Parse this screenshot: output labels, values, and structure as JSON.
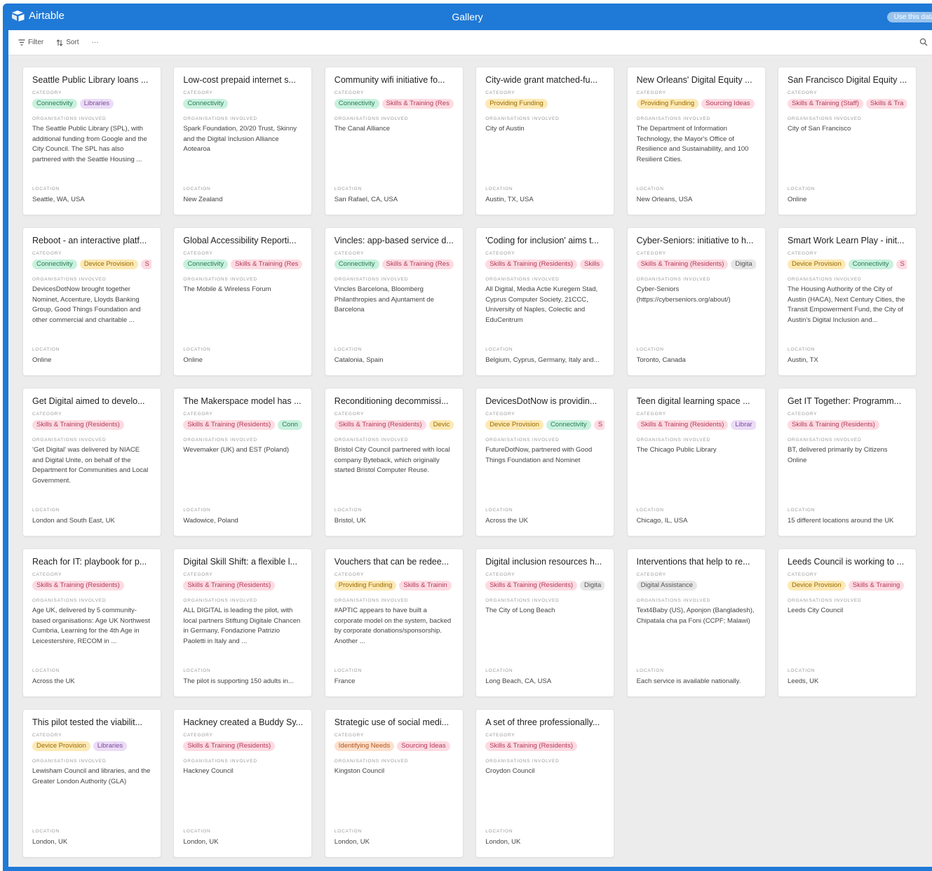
{
  "app": {
    "name": "Airtable",
    "view_title": "Gallery",
    "use_data_button": "Use this data"
  },
  "toolbar": {
    "filter_label": "Filter",
    "sort_label": "Sort",
    "more_label": "···"
  },
  "labels": {
    "category": "CATEGORY",
    "orgs": "ORGANISATIONS INVOLVED",
    "location": "LOCATION"
  },
  "tag_colors": {
    "Connectivity": {
      "bg": "#c8f1de",
      "fg": "#2a7a55"
    },
    "Libraries": {
      "bg": "#ecdcf7",
      "fg": "#7a4a99"
    },
    "Skills & Training": {
      "bg": "#fddbe2",
      "fg": "#b33a5a"
    },
    "Providing Funding": {
      "bg": "#fde9b5",
      "fg": "#9a6b00"
    },
    "Sourcing Ideas": {
      "bg": "#fddbe2",
      "fg": "#b33a5a"
    },
    "Device Provision": {
      "bg": "#fde9b5",
      "fg": "#9a6b00"
    },
    "Identifying Needs": {
      "bg": "#fde0cc",
      "fg": "#b0551e"
    },
    "Digital Assistance": {
      "bg": "#e6e6e6",
      "fg": "#555555"
    }
  },
  "cards": [
    {
      "title": "Seattle Public Library loans ...",
      "tags": [
        [
          "Connectivity",
          "Connectivity"
        ],
        [
          "Libraries",
          "Libraries"
        ]
      ],
      "orgs": "The Seattle Public Library (SPL), with additional funding from Google and the City Council. The SPL has also partnered with the Seattle Housing ...",
      "location": "Seattle, WA, USA"
    },
    {
      "title": "Low-cost prepaid internet s...",
      "tags": [
        [
          "Connectivity",
          "Connectivity"
        ]
      ],
      "orgs": "Spark Foundation, 20/20 Trust, Skinny and the Digital Inclusion Alliance Aotearoa",
      "location": "New Zealand"
    },
    {
      "title": "Community wifi initiative fo...",
      "tags": [
        [
          "Connectivity",
          "Connectivity"
        ],
        [
          "Skills & Training",
          "Skills & Training (Res"
        ]
      ],
      "orgs": "The Canal Alliance",
      "location": "San Rafael, CA, USA"
    },
    {
      "title": "City-wide grant matched-fu...",
      "tags": [
        [
          "Providing Funding",
          "Providing Funding"
        ]
      ],
      "orgs": "City of Austin",
      "location": "Austin, TX, USA"
    },
    {
      "title": "New Orleans' Digital Equity ...",
      "tags": [
        [
          "Providing Funding",
          "Providing Funding"
        ],
        [
          "Sourcing Ideas",
          "Sourcing Ideas"
        ]
      ],
      "orgs": "The Department of Information Technology, the Mayor's Office of Resilience and Sustainability, and 100 Resilient Cities.",
      "location": "New Orleans, USA"
    },
    {
      "title": "San Francisco Digital Equity ...",
      "tags": [
        [
          "Skills & Training",
          "Skills & Training (Staff)"
        ],
        [
          "Skills & Training",
          "Skills & Tra"
        ]
      ],
      "orgs": "City of San Francisco",
      "location": "Online"
    },
    {
      "title": "Reboot - an interactive platf...",
      "tags": [
        [
          "Connectivity",
          "Connectivity"
        ],
        [
          "Device Provision",
          "Device Provision"
        ],
        [
          "Skills & Training",
          "S"
        ]
      ],
      "orgs": "DevicesDotNow brought together Nominet, Accenture, Lloyds Banking Group, Good Things Foundation and other commercial and charitable ...",
      "location": "Online"
    },
    {
      "title": "Global Accessibility Reporti...",
      "tags": [
        [
          "Connectivity",
          "Connectivity"
        ],
        [
          "Skills & Training",
          "Skills & Training (Res"
        ]
      ],
      "orgs": "The Mobile & Wireless Forum",
      "location": "Online"
    },
    {
      "title": "Vincles: app-based service d...",
      "tags": [
        [
          "Connectivity",
          "Connectivity"
        ],
        [
          "Skills & Training",
          "Skills & Training (Res"
        ]
      ],
      "orgs": "Vincles Barcelona, Bloomberg Philanthropies and Ajuntament de Barcelona",
      "location": "Catalonia, Spain"
    },
    {
      "title": "'Coding for inclusion' aims t...",
      "tags": [
        [
          "Skills & Training",
          "Skills & Training (Residents)"
        ],
        [
          "Skills & Training",
          "Skills"
        ]
      ],
      "orgs": "All Digital, Media Actie Kuregem Stad, Cyprus Computer Society, 21CCC, University of Naples, Colectic and EduCentrum",
      "location": "Belgium, Cyprus, Germany, Italy and..."
    },
    {
      "title": "Cyber-Seniors: initiative to h...",
      "tags": [
        [
          "Skills & Training",
          "Skills & Training (Residents)"
        ],
        [
          "Digital Assistance",
          "Digita"
        ]
      ],
      "orgs": "Cyber-Seniors (https://cyberseniors.org/about/)",
      "location": "Toronto, Canada"
    },
    {
      "title": "Smart Work Learn Play - init...",
      "tags": [
        [
          "Device Provision",
          "Device Provision"
        ],
        [
          "Connectivity",
          "Connectivity"
        ],
        [
          "Skills & Training",
          "S"
        ]
      ],
      "orgs": "The Housing Authority of the City of Austin (HACA), Next Century Cities, the Transit Empowerment Fund, the City of Austin's Digital Inclusion and...",
      "location": "Austin, TX"
    },
    {
      "title": "Get Digital aimed to develo...",
      "tags": [
        [
          "Skills & Training",
          "Skills & Training (Residents)"
        ]
      ],
      "orgs": "'Get Digital' was delivered by NIACE and Digital Unite, on behalf of the Department for Communities and Local Government.",
      "location": "London and South East, UK"
    },
    {
      "title": "The Makerspace model has ...",
      "tags": [
        [
          "Skills & Training",
          "Skills & Training (Residents)"
        ],
        [
          "Connectivity",
          "Conn"
        ]
      ],
      "orgs": "Wevemaker (UK) and EST (Poland)",
      "location": "Wadowice, Poland"
    },
    {
      "title": "Reconditioning decommissi...",
      "tags": [
        [
          "Skills & Training",
          "Skills & Training (Residents)"
        ],
        [
          "Device Provision",
          "Devic"
        ]
      ],
      "orgs": "Bristol City Council partnered with local company Byteback, which originally started Bristol Computer Reuse.",
      "location": "Bristol, UK"
    },
    {
      "title": "DevicesDotNow is providin...",
      "tags": [
        [
          "Device Provision",
          "Device Provision"
        ],
        [
          "Connectivity",
          "Connectivity"
        ],
        [
          "Skills & Training",
          "S"
        ]
      ],
      "orgs": "FutureDotNow, partnered with Good Things Foundation and Nominet",
      "location": "Across the UK"
    },
    {
      "title": "Teen digital learning space ...",
      "tags": [
        [
          "Skills & Training",
          "Skills & Training (Residents)"
        ],
        [
          "Libraries",
          "Librar"
        ]
      ],
      "orgs": "The Chicago Public Library",
      "location": "Chicago, IL, USA"
    },
    {
      "title": "Get IT Together: Programm...",
      "tags": [
        [
          "Skills & Training",
          "Skills & Training (Residents)"
        ]
      ],
      "orgs": "BT, delivered primarily by Citizens Online",
      "location": "15 different locations around the UK"
    },
    {
      "title": "Reach for IT: playbook for p...",
      "tags": [
        [
          "Skills & Training",
          "Skills & Training (Residents)"
        ]
      ],
      "orgs": "Age UK, delivered by 5 community-based organisations: Age UK Northwest Cumbria, Learning for the 4th Age in Leicestershire, RECOM in ...",
      "location": "Across the UK"
    },
    {
      "title": "Digital Skill Shift: a flexible l...",
      "tags": [
        [
          "Skills & Training",
          "Skills & Training (Residents)"
        ]
      ],
      "orgs": "ALL DIGITAL is leading the pilot, with local partners Stiftung Digitale Chancen in Germany, Fondazione Patrizio Paoletti in Italy and ...",
      "location": "The pilot is supporting 150 adults in..."
    },
    {
      "title": "Vouchers that can be redee...",
      "tags": [
        [
          "Providing Funding",
          "Providing Funding"
        ],
        [
          "Skills & Training",
          "Skills & Trainin"
        ]
      ],
      "orgs": "#APTIC appears to have built a corporate model on the system, backed by corporate donations/sponsorship. Another ...",
      "location": "France"
    },
    {
      "title": "Digital inclusion resources h...",
      "tags": [
        [
          "Skills & Training",
          "Skills & Training (Residents)"
        ],
        [
          "Digital Assistance",
          "Digita"
        ]
      ],
      "orgs": "The City of Long Beach",
      "location": "Long Beach, CA, USA"
    },
    {
      "title": "Interventions that help to re...",
      "tags": [
        [
          "Digital Assistance",
          "Digital Assistance"
        ]
      ],
      "orgs": "Text4Baby (US), Aponjon (Bangladesh), Chipatala cha pa Foni (CCPF; Malawi)",
      "location": "Each service is available nationally."
    },
    {
      "title": "Leeds Council is working to ...",
      "tags": [
        [
          "Device Provision",
          "Device Provision"
        ],
        [
          "Skills & Training",
          "Skills & Training"
        ]
      ],
      "orgs": "Leeds City Council",
      "location": "Leeds, UK"
    },
    {
      "title": "This pilot tested the viabilit...",
      "tags": [
        [
          "Device Provision",
          "Device Provision"
        ],
        [
          "Libraries",
          "Libraries"
        ]
      ],
      "orgs": "Lewisham Council and libraries, and the Greater London Authority (GLA)",
      "location": "London, UK"
    },
    {
      "title": "Hackney created a Buddy Sy...",
      "tags": [
        [
          "Skills & Training",
          "Skills & Training (Residents)"
        ]
      ],
      "orgs": "Hackney Council",
      "location": "London, UK"
    },
    {
      "title": "Strategic use of social medi...",
      "tags": [
        [
          "Identifying Needs",
          "Identifying Needs"
        ],
        [
          "Sourcing Ideas",
          "Sourcing Ideas"
        ]
      ],
      "orgs": "Kingston Council",
      "location": "London, UK"
    },
    {
      "title": "A set of three professionally...",
      "tags": [
        [
          "Skills & Training",
          "Skills & Training (Residents)"
        ]
      ],
      "orgs": "Croydon Council",
      "location": "London, UK"
    }
  ]
}
